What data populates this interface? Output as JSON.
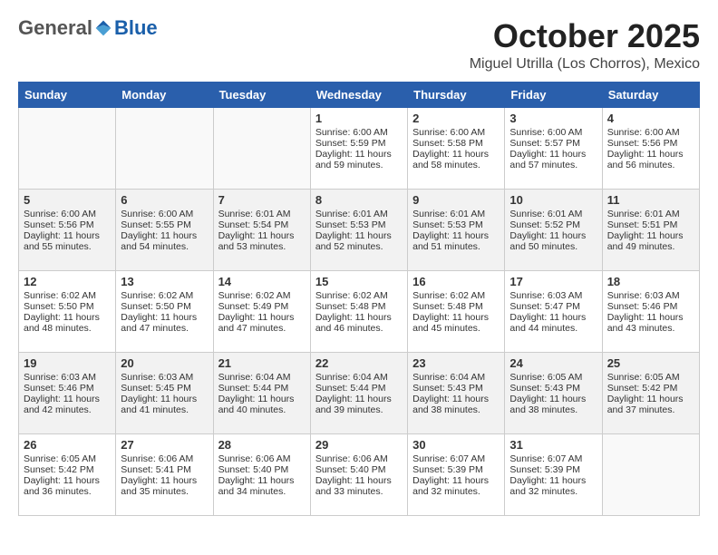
{
  "header": {
    "logo_general": "General",
    "logo_blue": "Blue",
    "month_title": "October 2025",
    "location": "Miguel Utrilla (Los Chorros), Mexico"
  },
  "weekdays": [
    "Sunday",
    "Monday",
    "Tuesday",
    "Wednesday",
    "Thursday",
    "Friday",
    "Saturday"
  ],
  "weeks": [
    [
      {
        "day": "",
        "sunrise": "",
        "sunset": "",
        "daylight": ""
      },
      {
        "day": "",
        "sunrise": "",
        "sunset": "",
        "daylight": ""
      },
      {
        "day": "",
        "sunrise": "",
        "sunset": "",
        "daylight": ""
      },
      {
        "day": "1",
        "sunrise": "Sunrise: 6:00 AM",
        "sunset": "Sunset: 5:59 PM",
        "daylight": "Daylight: 11 hours and 59 minutes."
      },
      {
        "day": "2",
        "sunrise": "Sunrise: 6:00 AM",
        "sunset": "Sunset: 5:58 PM",
        "daylight": "Daylight: 11 hours and 58 minutes."
      },
      {
        "day": "3",
        "sunrise": "Sunrise: 6:00 AM",
        "sunset": "Sunset: 5:57 PM",
        "daylight": "Daylight: 11 hours and 57 minutes."
      },
      {
        "day": "4",
        "sunrise": "Sunrise: 6:00 AM",
        "sunset": "Sunset: 5:56 PM",
        "daylight": "Daylight: 11 hours and 56 minutes."
      }
    ],
    [
      {
        "day": "5",
        "sunrise": "Sunrise: 6:00 AM",
        "sunset": "Sunset: 5:56 PM",
        "daylight": "Daylight: 11 hours and 55 minutes."
      },
      {
        "day": "6",
        "sunrise": "Sunrise: 6:00 AM",
        "sunset": "Sunset: 5:55 PM",
        "daylight": "Daylight: 11 hours and 54 minutes."
      },
      {
        "day": "7",
        "sunrise": "Sunrise: 6:01 AM",
        "sunset": "Sunset: 5:54 PM",
        "daylight": "Daylight: 11 hours and 53 minutes."
      },
      {
        "day": "8",
        "sunrise": "Sunrise: 6:01 AM",
        "sunset": "Sunset: 5:53 PM",
        "daylight": "Daylight: 11 hours and 52 minutes."
      },
      {
        "day": "9",
        "sunrise": "Sunrise: 6:01 AM",
        "sunset": "Sunset: 5:53 PM",
        "daylight": "Daylight: 11 hours and 51 minutes."
      },
      {
        "day": "10",
        "sunrise": "Sunrise: 6:01 AM",
        "sunset": "Sunset: 5:52 PM",
        "daylight": "Daylight: 11 hours and 50 minutes."
      },
      {
        "day": "11",
        "sunrise": "Sunrise: 6:01 AM",
        "sunset": "Sunset: 5:51 PM",
        "daylight": "Daylight: 11 hours and 49 minutes."
      }
    ],
    [
      {
        "day": "12",
        "sunrise": "Sunrise: 6:02 AM",
        "sunset": "Sunset: 5:50 PM",
        "daylight": "Daylight: 11 hours and 48 minutes."
      },
      {
        "day": "13",
        "sunrise": "Sunrise: 6:02 AM",
        "sunset": "Sunset: 5:50 PM",
        "daylight": "Daylight: 11 hours and 47 minutes."
      },
      {
        "day": "14",
        "sunrise": "Sunrise: 6:02 AM",
        "sunset": "Sunset: 5:49 PM",
        "daylight": "Daylight: 11 hours and 47 minutes."
      },
      {
        "day": "15",
        "sunrise": "Sunrise: 6:02 AM",
        "sunset": "Sunset: 5:48 PM",
        "daylight": "Daylight: 11 hours and 46 minutes."
      },
      {
        "day": "16",
        "sunrise": "Sunrise: 6:02 AM",
        "sunset": "Sunset: 5:48 PM",
        "daylight": "Daylight: 11 hours and 45 minutes."
      },
      {
        "day": "17",
        "sunrise": "Sunrise: 6:03 AM",
        "sunset": "Sunset: 5:47 PM",
        "daylight": "Daylight: 11 hours and 44 minutes."
      },
      {
        "day": "18",
        "sunrise": "Sunrise: 6:03 AM",
        "sunset": "Sunset: 5:46 PM",
        "daylight": "Daylight: 11 hours and 43 minutes."
      }
    ],
    [
      {
        "day": "19",
        "sunrise": "Sunrise: 6:03 AM",
        "sunset": "Sunset: 5:46 PM",
        "daylight": "Daylight: 11 hours and 42 minutes."
      },
      {
        "day": "20",
        "sunrise": "Sunrise: 6:03 AM",
        "sunset": "Sunset: 5:45 PM",
        "daylight": "Daylight: 11 hours and 41 minutes."
      },
      {
        "day": "21",
        "sunrise": "Sunrise: 6:04 AM",
        "sunset": "Sunset: 5:44 PM",
        "daylight": "Daylight: 11 hours and 40 minutes."
      },
      {
        "day": "22",
        "sunrise": "Sunrise: 6:04 AM",
        "sunset": "Sunset: 5:44 PM",
        "daylight": "Daylight: 11 hours and 39 minutes."
      },
      {
        "day": "23",
        "sunrise": "Sunrise: 6:04 AM",
        "sunset": "Sunset: 5:43 PM",
        "daylight": "Daylight: 11 hours and 38 minutes."
      },
      {
        "day": "24",
        "sunrise": "Sunrise: 6:05 AM",
        "sunset": "Sunset: 5:43 PM",
        "daylight": "Daylight: 11 hours and 38 minutes."
      },
      {
        "day": "25",
        "sunrise": "Sunrise: 6:05 AM",
        "sunset": "Sunset: 5:42 PM",
        "daylight": "Daylight: 11 hours and 37 minutes."
      }
    ],
    [
      {
        "day": "26",
        "sunrise": "Sunrise: 6:05 AM",
        "sunset": "Sunset: 5:42 PM",
        "daylight": "Daylight: 11 hours and 36 minutes."
      },
      {
        "day": "27",
        "sunrise": "Sunrise: 6:06 AM",
        "sunset": "Sunset: 5:41 PM",
        "daylight": "Daylight: 11 hours and 35 minutes."
      },
      {
        "day": "28",
        "sunrise": "Sunrise: 6:06 AM",
        "sunset": "Sunset: 5:40 PM",
        "daylight": "Daylight: 11 hours and 34 minutes."
      },
      {
        "day": "29",
        "sunrise": "Sunrise: 6:06 AM",
        "sunset": "Sunset: 5:40 PM",
        "daylight": "Daylight: 11 hours and 33 minutes."
      },
      {
        "day": "30",
        "sunrise": "Sunrise: 6:07 AM",
        "sunset": "Sunset: 5:39 PM",
        "daylight": "Daylight: 11 hours and 32 minutes."
      },
      {
        "day": "31",
        "sunrise": "Sunrise: 6:07 AM",
        "sunset": "Sunset: 5:39 PM",
        "daylight": "Daylight: 11 hours and 32 minutes."
      },
      {
        "day": "",
        "sunrise": "",
        "sunset": "",
        "daylight": ""
      }
    ]
  ]
}
